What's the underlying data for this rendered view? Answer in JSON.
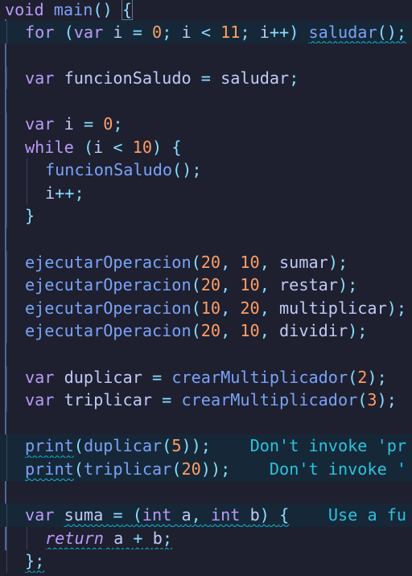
{
  "editor": {
    "colors": {
      "background": "#1e2030",
      "current_line_highlight": "#162838",
      "keyword": "#bb9af7",
      "function": "#7aa2f7",
      "identifier": "#c0caf5",
      "number": "#ff9e64",
      "punctuation": "#89ddff",
      "hint": "#2ac3de",
      "warning_squiggle": "#0db9d7"
    },
    "lines": [
      "void main() {",
      "  for (var i = 0; i < 11; i++) saludar();",
      "",
      "  var funcionSaludo = saludar;",
      "",
      "  var i = 0;",
      "  while (i < 10) {",
      "    funcionSaludo();",
      "    i++;",
      "  }",
      "",
      "  ejecutarOperacion(20, 10, sumar);",
      "  ejecutarOperacion(20, 10, restar);",
      "  ejecutarOperacion(10, 20, multiplicar);",
      "  ejecutarOperacion(20, 10, dividir);",
      "",
      "  var duplicar = crearMultiplicador(2);",
      "  var triplicar = crearMultiplicador(3);",
      "",
      "  print(duplicar(5));    Don't invoke 'pr",
      "  print(triplicar(20));    Don't invoke '",
      "",
      "  var suma = (int a, int b) {    Use a fu",
      "    return a + b;",
      "  };"
    ],
    "hints": {
      "print_duplicar": "Don't invoke 'pr",
      "print_triplicar": "Don't invoke '",
      "suma": "Use a fu"
    }
  }
}
